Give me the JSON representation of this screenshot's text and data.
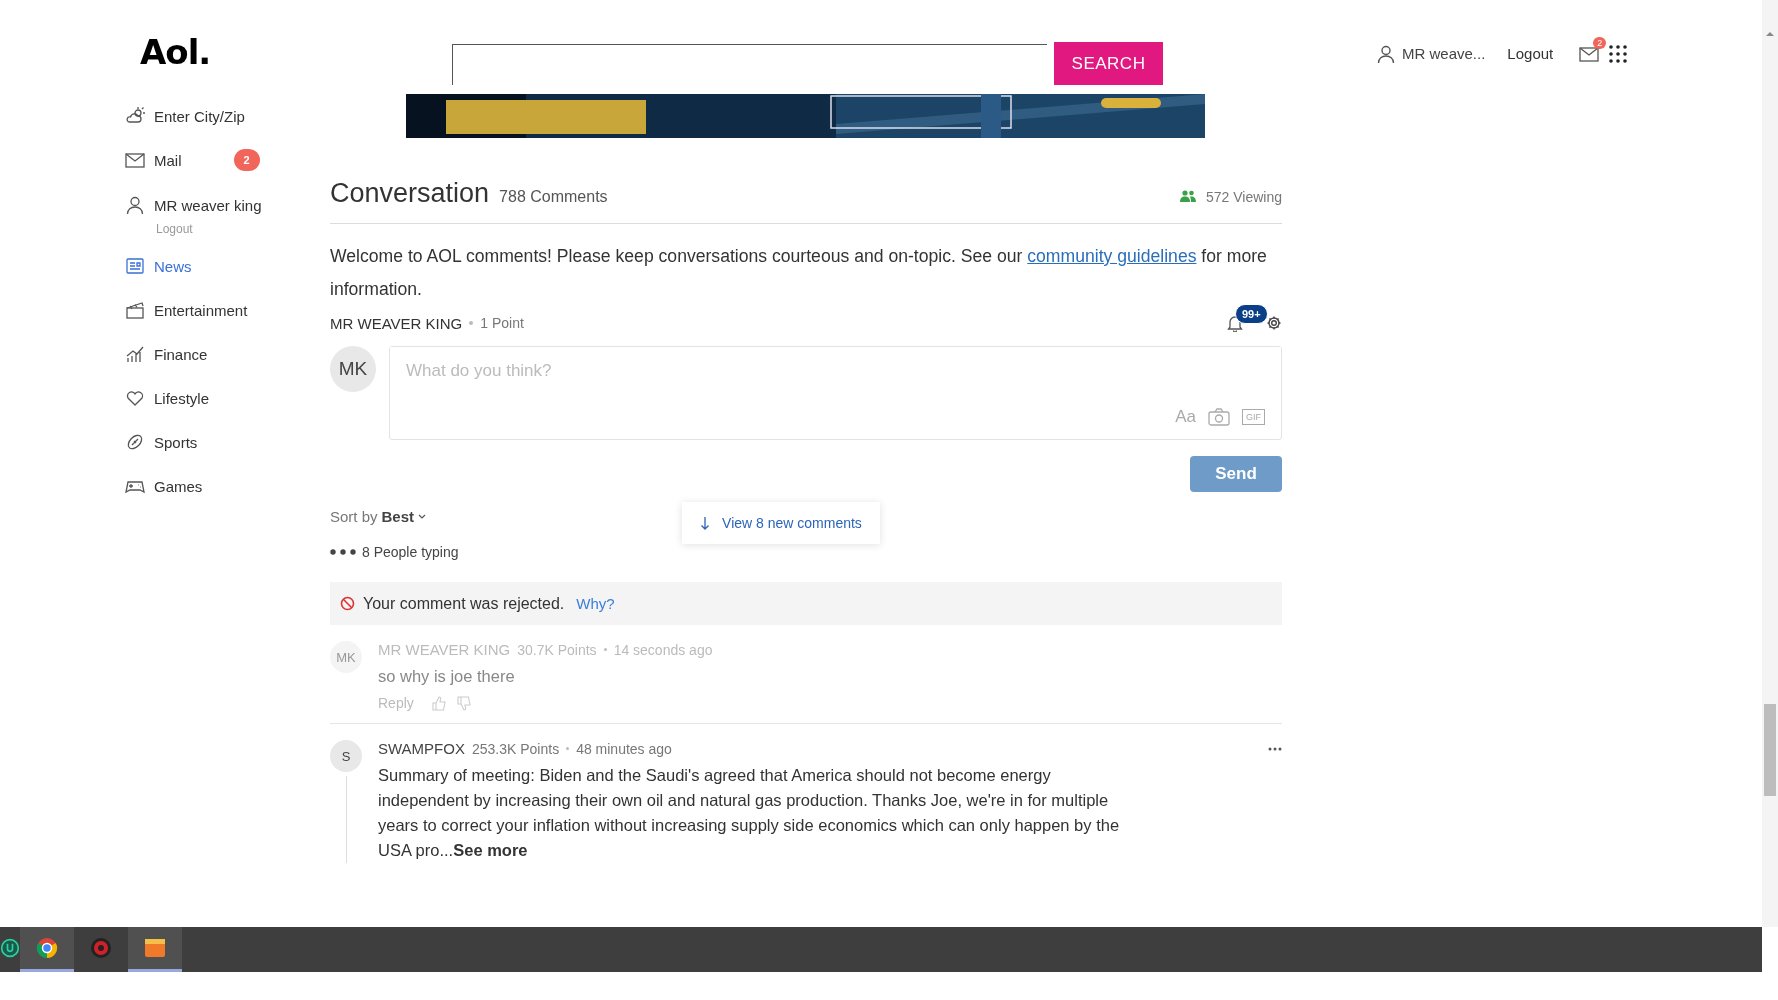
{
  "header": {
    "logo": "Aol.",
    "search_button": "SEARCH",
    "user": "MR weave...",
    "logout": "Logout",
    "mail_badge": "2"
  },
  "sidebar": {
    "items": [
      {
        "kind": "weather",
        "label": "Enter City/Zip",
        "selected": false
      },
      {
        "kind": "mail",
        "label": "Mail",
        "badge": "2",
        "selected": false
      },
      {
        "kind": "user",
        "label": "MR weaver king",
        "sublabel": "Logout",
        "selected": false
      },
      {
        "kind": "news",
        "label": "News",
        "selected": true
      },
      {
        "kind": "entertainment",
        "label": "Entertainment",
        "selected": false
      },
      {
        "kind": "finance",
        "label": "Finance",
        "selected": false
      },
      {
        "kind": "lifestyle",
        "label": "Lifestyle",
        "selected": false
      },
      {
        "kind": "sports",
        "label": "Sports",
        "selected": false
      },
      {
        "kind": "games",
        "label": "Games",
        "selected": false
      }
    ]
  },
  "conversation": {
    "title": "Conversation",
    "count": "788 Comments",
    "viewing": "572 Viewing",
    "welcome": "Welcome to AOL comments! Please keep conversations courteous and on-topic. See our",
    "guidelines_link": "community guidelines",
    "welcome_end": "for more information.",
    "user": {
      "name": "MR WEAVER KING",
      "points": "1 Point",
      "notifications": "99+",
      "initials": "MK"
    },
    "composer": {
      "placeholder": "What do you think?",
      "format": "Aa",
      "gif": "GIF",
      "send": "Send"
    },
    "sort": {
      "label": "Sort by",
      "value": "Best"
    },
    "new_comments": "View 8 new comments",
    "typing": "8 People typing",
    "rejected": {
      "text": "Your comment was rejected.",
      "link": "Why?"
    },
    "comments": [
      {
        "initials": "MK",
        "name": "MR WEAVER KING",
        "points": "30.7K Points",
        "time": "14 seconds ago",
        "text": "so why is joe there",
        "pending": true,
        "reply": "Reply",
        "menu": false
      },
      {
        "initials": "S",
        "name": "SWAMPFOX",
        "points": "253.3K Points",
        "time": "48 minutes ago",
        "text": "Summary of meeting: Biden and the Saudi's agreed that America should not become energy independent by increasing their own oil and natural gas production. Thanks Joe, we're in for multiple years to correct your inflation without increasing supply side economics which can only happen by the USA  pro...",
        "see_more": "See more",
        "pending": false,
        "menu": true
      }
    ]
  },
  "taskbar": {
    "apps": [
      {
        "kind": "u",
        "selected": false
      },
      {
        "kind": "chrome",
        "selected": true
      },
      {
        "kind": "red",
        "selected": false
      },
      {
        "kind": "orange",
        "selected": true
      }
    ]
  }
}
